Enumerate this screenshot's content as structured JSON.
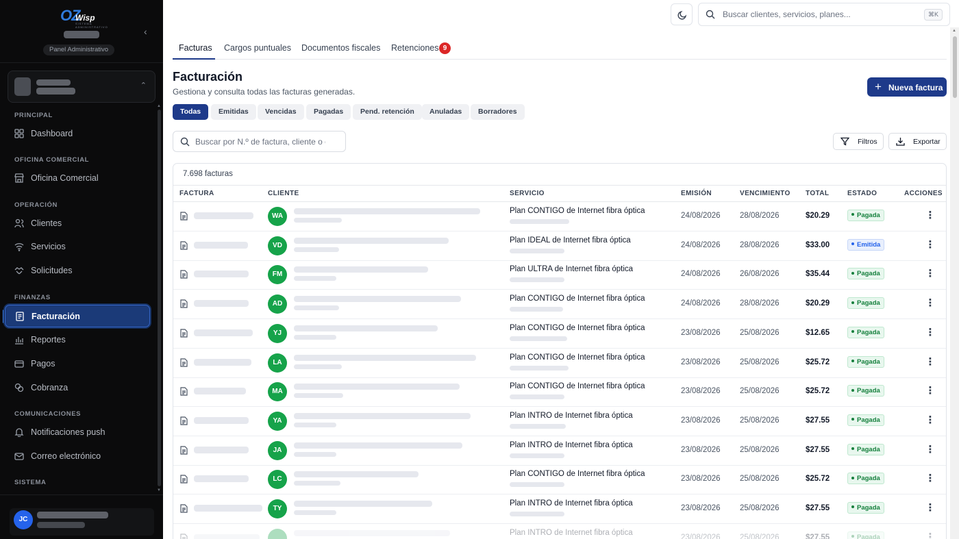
{
  "brand": {
    "logo_main": "OZ",
    "logo_accent": "Wisp",
    "logo_tagline": "SISTEMA ADMINISTRATIVO",
    "panel_label": "Panel Administrativo"
  },
  "sidebar": {
    "sections": [
      {
        "title": "PRINCIPAL"
      },
      {
        "title": "OFICINA COMERCIAL"
      },
      {
        "title": "OPERACIÓN"
      },
      {
        "title": "FINANZAS"
      },
      {
        "title": "COMUNICACIONES"
      },
      {
        "title": "SISTEMA"
      }
    ],
    "items": [
      {
        "label": "Dashboard",
        "icon": "grid-icon"
      },
      {
        "label": "Oficina Comercial",
        "icon": "store-icon"
      },
      {
        "label": "Clientes",
        "icon": "users-icon"
      },
      {
        "label": "Servicios",
        "icon": "wifi-icon"
      },
      {
        "label": "Solicitudes",
        "icon": "handshake-icon"
      },
      {
        "label": "Facturación",
        "icon": "invoice-icon",
        "active": true
      },
      {
        "label": "Reportes",
        "icon": "bar-chart-icon"
      },
      {
        "label": "Pagos",
        "icon": "card-icon"
      },
      {
        "label": "Cobranza",
        "icon": "coins-icon"
      },
      {
        "label": "Notificaciones push",
        "icon": "bell-icon"
      },
      {
        "label": "Correo electrónico",
        "icon": "mail-icon"
      }
    ],
    "user_initials": "JC"
  },
  "topbar": {
    "search_placeholder": "Buscar clientes, servicios, planes...",
    "shortcut": "⌘K"
  },
  "tabs": [
    {
      "label": "Facturas",
      "active": true
    },
    {
      "label": "Cargos puntuales"
    },
    {
      "label": "Documentos fiscales"
    },
    {
      "label": "Retenciones",
      "badge": "9"
    }
  ],
  "header": {
    "title": "Facturación",
    "subtitle": "Gestiona y consulta todas las facturas generadas.",
    "new_button": "Nueva factura"
  },
  "filters": [
    "Todas",
    "Emitidas",
    "Vencidas",
    "Pagadas",
    "Pend. retención",
    "Anuladas",
    "Borradores"
  ],
  "search": {
    "placeholder": "Buscar por N.º de factura, cliente o c"
  },
  "actions": {
    "filters": "Filtros",
    "export": "Exportar"
  },
  "table": {
    "count": "7.698 facturas",
    "columns": [
      "FACTURA",
      "CLIENTE",
      "SERVICIO",
      "EMISIÓN",
      "VENCIMIENTO",
      "TOTAL",
      "ESTADO",
      "ACCIONES"
    ],
    "rows": [
      {
        "initials": "WA",
        "service": "Plan CONTIGO de Internet fibra óptica",
        "issued": "24/08/2026",
        "due": "28/08/2026",
        "total": "$20.29",
        "status": "Pagada"
      },
      {
        "initials": "VD",
        "service": "Plan IDEAL de Internet fibra óptica",
        "issued": "24/08/2026",
        "due": "28/08/2026",
        "total": "$33.00",
        "status": "Emitida"
      },
      {
        "initials": "FM",
        "service": "Plan ULTRA de Internet fibra óptica",
        "issued": "24/08/2026",
        "due": "26/08/2026",
        "total": "$35.44",
        "status": "Pagada"
      },
      {
        "initials": "AD",
        "service": "Plan CONTIGO de Internet fibra óptica",
        "issued": "24/08/2026",
        "due": "28/08/2026",
        "total": "$20.29",
        "status": "Pagada"
      },
      {
        "initials": "YJ",
        "service": "Plan CONTIGO de Internet fibra óptica",
        "issued": "23/08/2026",
        "due": "25/08/2026",
        "total": "$12.65",
        "status": "Pagada"
      },
      {
        "initials": "LA",
        "service": "Plan CONTIGO de Internet fibra óptica",
        "issued": "23/08/2026",
        "due": "25/08/2026",
        "total": "$25.72",
        "status": "Pagada"
      },
      {
        "initials": "MA",
        "service": "Plan CONTIGO de Internet fibra óptica",
        "issued": "23/08/2026",
        "due": "25/08/2026",
        "total": "$25.72",
        "status": "Pagada"
      },
      {
        "initials": "YA",
        "service": "Plan INTRO de Internet fibra óptica",
        "issued": "23/08/2026",
        "due": "25/08/2026",
        "total": "$27.55",
        "status": "Pagada"
      },
      {
        "initials": "JA",
        "service": "Plan INTRO de Internet fibra óptica",
        "issued": "23/08/2026",
        "due": "25/08/2026",
        "total": "$27.55",
        "status": "Pagada"
      },
      {
        "initials": "LC",
        "service": "Plan CONTIGO de Internet fibra óptica",
        "issued": "23/08/2026",
        "due": "25/08/2026",
        "total": "$25.72",
        "status": "Pagada"
      },
      {
        "initials": "TY",
        "service": "Plan INTRO de Internet fibra óptica",
        "issued": "23/08/2026",
        "due": "25/08/2026",
        "total": "$27.55",
        "status": "Pagada"
      },
      {
        "initials": "",
        "service": "Plan INTRO de Internet fibra óptica",
        "issued": "23/08/2026",
        "due": "25/08/2026",
        "total": "$27.55",
        "status": "Pagada"
      }
    ]
  },
  "colors": {
    "primary": "#1e3a8a",
    "sidebar_bg": "#0b0b0c",
    "success": "#16a34a",
    "badge_red": "#dc2626"
  }
}
